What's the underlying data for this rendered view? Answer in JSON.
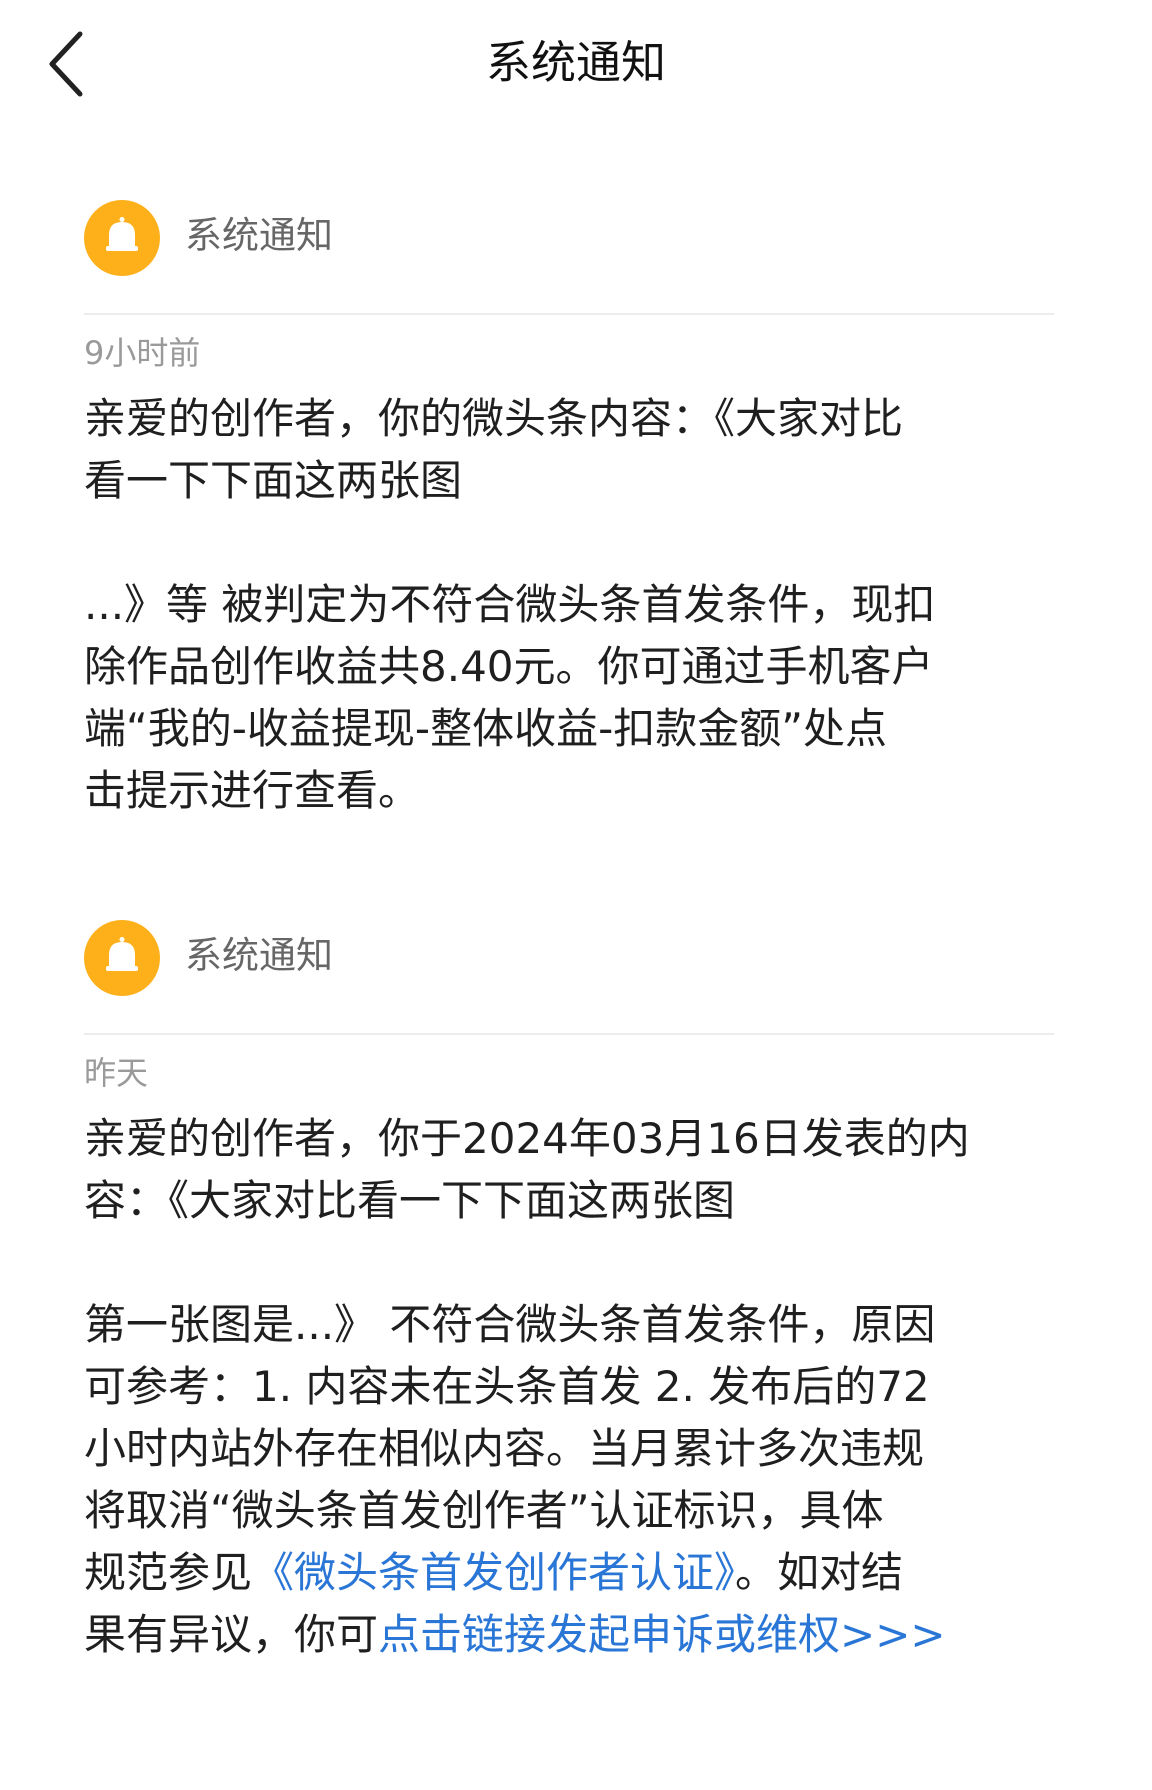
{
  "header": {
    "title": "系统通知"
  },
  "icons": {
    "back": "chevron-left-icon",
    "avatar": "bell-icon"
  },
  "colors": {
    "avatar_bg": "#FDB019",
    "link": "#2A76D6"
  },
  "notices": [
    {
      "sender": "系统通知",
      "time": "9小时前",
      "lines": [
        "亲爱的创作者，你的微头条内容：《大家对比",
        "看一下下面这两张图",
        "",
        "...》等 被判定为不符合微头条首发条件，现扣",
        "除作品创作收益共8.40元。你可通过手机客户",
        "端“我的-收益提现-整体收益-扣款金额”处点",
        "击提示进行查看。"
      ]
    },
    {
      "sender": "系统通知",
      "time": "昨天",
      "lines": [
        "亲爱的创作者，你于2024年03月16日发表的内",
        "容：《大家对比看一下下面这两张图",
        "",
        "第一张图是...》 不符合微头条首发条件，原因",
        "可参考：1. 内容未在头条首发 2. 发布后的72",
        "小时内站外存在相似内容。当月累计多次违规",
        "将取消“微头条首发创作者”认证标识，具体"
      ],
      "line8_prefix": "规范参见",
      "line8_link": "《微头条首发创作者认证》",
      "line8_suffix": "。如对结",
      "line9_prefix": "果有异议，你可",
      "line9_link": "点击链接发起申诉或维权>>>"
    }
  ]
}
